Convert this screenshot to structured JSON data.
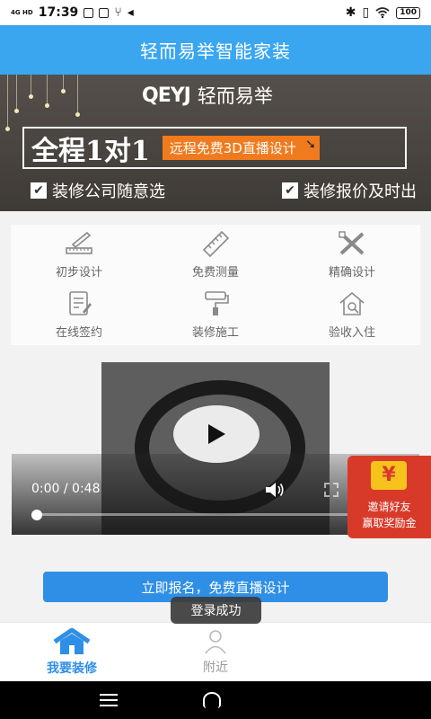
{
  "status_bar": {
    "network": "4G HD",
    "time": "17:39",
    "battery": "100"
  },
  "header": {
    "title": "轻而易举智能家装"
  },
  "banner": {
    "logo_mark": "QEYJ",
    "logo_text": "轻而易举",
    "slogan": "全程1对1",
    "slogan_tag": "远程免费3D直播设计",
    "checks": [
      "装修公司随意选",
      "装修报价及时出"
    ]
  },
  "steps": [
    {
      "label": "初步设计",
      "icon": "ruler-pencil-icon"
    },
    {
      "label": "免费测量",
      "icon": "tape-measure-icon"
    },
    {
      "label": "精确设计",
      "icon": "design-tools-icon"
    },
    {
      "label": "在线签约",
      "icon": "contract-icon"
    },
    {
      "label": "装修施工",
      "icon": "paint-roller-icon"
    },
    {
      "label": "验收入住",
      "icon": "house-inspect-icon"
    }
  ],
  "video": {
    "time": "0:00 / 0:48",
    "progress": 0
  },
  "invite": {
    "coin": "¥",
    "line1": "邀请好友",
    "line2": "赢取奖励金"
  },
  "cta": {
    "label": "立即报名，免费直播设计"
  },
  "toast": {
    "text": "登录成功"
  },
  "tabs": [
    {
      "label": "我要装修",
      "active": true
    },
    {
      "label": "附近",
      "active": false
    }
  ],
  "colors": {
    "primary": "#3aa6f0",
    "button": "#2f8fe6",
    "accent_orange": "#f07a1e",
    "invite_red": "#d83a2a"
  }
}
